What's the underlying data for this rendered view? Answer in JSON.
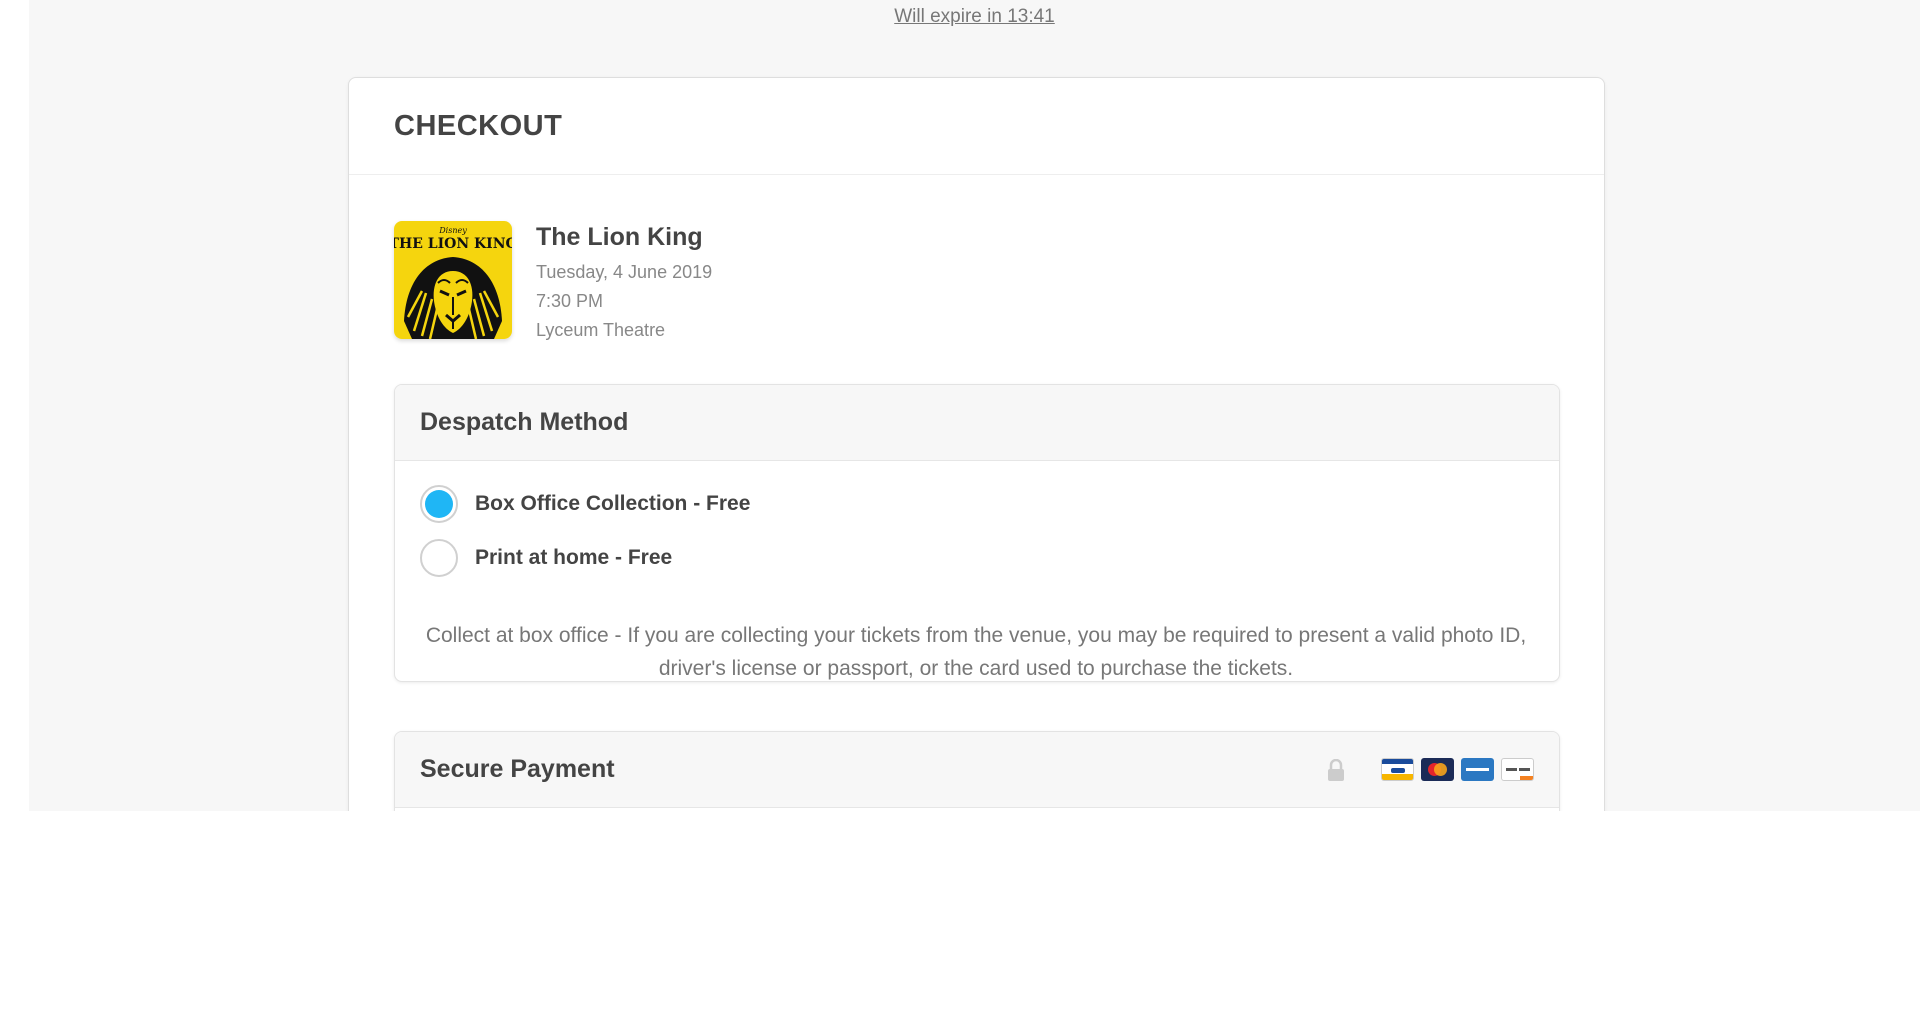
{
  "timer": {
    "text": "Will expire in 13:41"
  },
  "checkout": {
    "title": "CHECKOUT"
  },
  "event": {
    "title": "The Lion King",
    "date": "Tuesday, 4 June 2019",
    "time": "7:30 PM",
    "venue": "Lyceum Theatre",
    "poster": {
      "brand": "Disney",
      "line1": "THE LION KING",
      "bg_color": "#f5d50e"
    }
  },
  "despatch": {
    "title": "Despatch Method",
    "options": [
      {
        "label": "Box Office Collection - Free",
        "selected": true
      },
      {
        "label": "Print at home - Free",
        "selected": false
      }
    ],
    "note": "Collect at box office - If you are collecting your tickets from the venue, you may be required to present a valid photo ID, driver's license or passport, or the card used to purchase the tickets."
  },
  "payment": {
    "title": "Secure Payment",
    "icons": [
      "lock-icon",
      "visa-card-icon",
      "mastercard-icon",
      "amex-card-icon",
      "discover-card-icon"
    ]
  },
  "colors": {
    "accent": "#1fb6f5",
    "page_bg": "#f7f7f7",
    "text": "#444444",
    "muted": "#888888"
  }
}
